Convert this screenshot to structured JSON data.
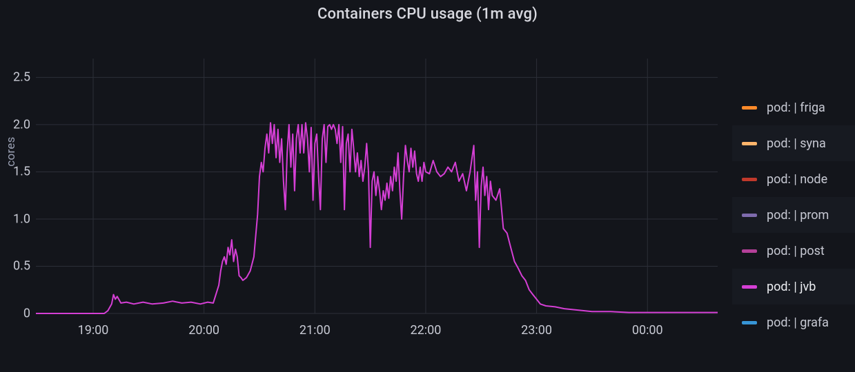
{
  "title": "Containers CPU usage (1m avg)",
  "ylabel": "cores",
  "chart_data": {
    "type": "line",
    "title": "Containers CPU usage (1m avg)",
    "xlabel": "",
    "ylabel": "cores",
    "ylim": [
      0,
      2.7
    ],
    "yticks": [
      0,
      0.5,
      1.0,
      1.5,
      2.0,
      2.5
    ],
    "xlim_minutes": [
      1109,
      1478
    ],
    "xticks_minutes": [
      1140,
      1200,
      1260,
      1320,
      1380,
      1440
    ],
    "xtick_labels": [
      "19:00",
      "20:00",
      "21:00",
      "22:00",
      "23:00",
      "00:00"
    ],
    "series": [
      {
        "name": "pod: | friga",
        "color": "#ff8a2a",
        "visible": false
      },
      {
        "name": "pod: | syna",
        "color": "#ffb56b",
        "visible": false
      },
      {
        "name": "pod: | node",
        "color": "#c0392b",
        "visible": false
      },
      {
        "name": "pod: | prom",
        "color": "#7e6bad",
        "visible": false
      },
      {
        "name": "pod: | post",
        "color": "#b54099",
        "visible": false
      },
      {
        "name": "pod: | jvb",
        "color": "#d53fd5",
        "visible": true
      },
      {
        "name": "pod: | grafa",
        "color": "#3795d6",
        "visible": false
      }
    ],
    "jvb_points": [
      [
        1109,
        0.0
      ],
      [
        1145,
        0.0
      ],
      [
        1146,
        0.0
      ],
      [
        1148,
        0.03
      ],
      [
        1150,
        0.1
      ],
      [
        1151,
        0.2
      ],
      [
        1152,
        0.15
      ],
      [
        1153,
        0.18
      ],
      [
        1155,
        0.11
      ],
      [
        1158,
        0.12
      ],
      [
        1162,
        0.1
      ],
      [
        1167,
        0.12
      ],
      [
        1172,
        0.1
      ],
      [
        1178,
        0.11
      ],
      [
        1183,
        0.13
      ],
      [
        1188,
        0.11
      ],
      [
        1193,
        0.12
      ],
      [
        1198,
        0.1
      ],
      [
        1202,
        0.12
      ],
      [
        1205,
        0.11
      ],
      [
        1208,
        0.3
      ],
      [
        1209,
        0.45
      ],
      [
        1210,
        0.55
      ],
      [
        1211,
        0.6
      ],
      [
        1212,
        0.52
      ],
      [
        1213,
        0.7
      ],
      [
        1214,
        0.62
      ],
      [
        1215,
        0.78
      ],
      [
        1216,
        0.55
      ],
      [
        1217,
        0.68
      ],
      [
        1218,
        0.6
      ],
      [
        1219,
        0.4
      ],
      [
        1220,
        0.38
      ],
      [
        1221,
        0.35
      ],
      [
        1223,
        0.38
      ],
      [
        1225,
        0.45
      ],
      [
        1227,
        0.6
      ],
      [
        1229,
        1.05
      ],
      [
        1230,
        1.45
      ],
      [
        1231,
        1.6
      ],
      [
        1232,
        1.5
      ],
      [
        1233,
        1.75
      ],
      [
        1234,
        1.9
      ],
      [
        1235,
        1.7
      ],
      [
        1236,
        2.02
      ],
      [
        1237,
        1.8
      ],
      [
        1238,
        2.0
      ],
      [
        1239,
        1.65
      ],
      [
        1240,
        1.95
      ],
      [
        1241,
        1.6
      ],
      [
        1242,
        1.85
      ],
      [
        1243,
        1.4
      ],
      [
        1244,
        1.1
      ],
      [
        1245,
        1.7
      ],
      [
        1246,
        2.0
      ],
      [
        1247,
        1.55
      ],
      [
        1248,
        1.9
      ],
      [
        1249,
        1.3
      ],
      [
        1250,
        1.85
      ],
      [
        1251,
        2.0
      ],
      [
        1252,
        1.7
      ],
      [
        1253,
        2.0
      ],
      [
        1254,
        1.7
      ],
      [
        1255,
        2.02
      ],
      [
        1256,
        1.85
      ],
      [
        1257,
        1.5
      ],
      [
        1258,
        1.97
      ],
      [
        1259,
        1.2
      ],
      [
        1260,
        1.8
      ],
      [
        1261,
        1.9
      ],
      [
        1262,
        1.45
      ],
      [
        1263,
        1.1
      ],
      [
        1264,
        1.85
      ],
      [
        1265,
        2.0
      ],
      [
        1266,
        1.6
      ],
      [
        1267,
        1.98
      ],
      [
        1268,
        2.0
      ],
      [
        1269,
        1.95
      ],
      [
        1270,
        2.0
      ],
      [
        1271,
        1.95
      ],
      [
        1272,
        1.8
      ],
      [
        1273,
        2.0
      ],
      [
        1274,
        1.6
      ],
      [
        1275,
        1.98
      ],
      [
        1276,
        1.1
      ],
      [
        1277,
        1.8
      ],
      [
        1278,
        1.9
      ],
      [
        1279,
        1.5
      ],
      [
        1280,
        1.95
      ],
      [
        1281,
        1.75
      ],
      [
        1282,
        1.5
      ],
      [
        1283,
        1.7
      ],
      [
        1284,
        1.45
      ],
      [
        1285,
        1.62
      ],
      [
        1286,
        1.4
      ],
      [
        1287,
        1.55
      ],
      [
        1288,
        1.8
      ],
      [
        1289,
        1.5
      ],
      [
        1290,
        0.7
      ],
      [
        1291,
        1.4
      ],
      [
        1292,
        1.5
      ],
      [
        1293,
        1.25
      ],
      [
        1294,
        1.45
      ],
      [
        1295,
        1.3
      ],
      [
        1296,
        1.1
      ],
      [
        1297,
        1.3
      ],
      [
        1298,
        1.2
      ],
      [
        1299,
        1.38
      ],
      [
        1300,
        1.22
      ],
      [
        1301,
        1.45
      ],
      [
        1302,
        1.3
      ],
      [
        1303,
        1.55
      ],
      [
        1304,
        1.4
      ],
      [
        1305,
        1.7
      ],
      [
        1306,
        1.3
      ],
      [
        1307,
        1.0
      ],
      [
        1308,
        1.45
      ],
      [
        1309,
        1.78
      ],
      [
        1310,
        1.62
      ],
      [
        1311,
        1.5
      ],
      [
        1312,
        1.75
      ],
      [
        1313,
        1.55
      ],
      [
        1314,
        1.72
      ],
      [
        1315,
        1.48
      ],
      [
        1316,
        1.4
      ],
      [
        1317,
        1.55
      ],
      [
        1318,
        1.4
      ],
      [
        1319,
        1.6
      ],
      [
        1320,
        1.5
      ],
      [
        1322,
        1.48
      ],
      [
        1324,
        1.62
      ],
      [
        1326,
        1.5
      ],
      [
        1328,
        1.45
      ],
      [
        1330,
        1.48
      ],
      [
        1332,
        1.55
      ],
      [
        1334,
        1.5
      ],
      [
        1336,
        1.6
      ],
      [
        1338,
        1.4
      ],
      [
        1340,
        1.48
      ],
      [
        1342,
        1.3
      ],
      [
        1344,
        1.5
      ],
      [
        1346,
        1.78
      ],
      [
        1347,
        1.2
      ],
      [
        1348,
        1.5
      ],
      [
        1349,
        0.7
      ],
      [
        1350,
        1.35
      ],
      [
        1351,
        1.55
      ],
      [
        1352,
        1.25
      ],
      [
        1353,
        1.45
      ],
      [
        1354,
        1.1
      ],
      [
        1355,
        1.4
      ],
      [
        1356,
        1.25
      ],
      [
        1358,
        1.2
      ],
      [
        1360,
        1.32
      ],
      [
        1362,
        0.9
      ],
      [
        1364,
        0.85
      ],
      [
        1366,
        0.7
      ],
      [
        1368,
        0.55
      ],
      [
        1370,
        0.48
      ],
      [
        1372,
        0.4
      ],
      [
        1374,
        0.35
      ],
      [
        1376,
        0.25
      ],
      [
        1378,
        0.2
      ],
      [
        1380,
        0.15
      ],
      [
        1382,
        0.1
      ],
      [
        1385,
        0.08
      ],
      [
        1390,
        0.07
      ],
      [
        1395,
        0.05
      ],
      [
        1400,
        0.04
      ],
      [
        1410,
        0.02
      ],
      [
        1420,
        0.02
      ],
      [
        1430,
        0.01
      ],
      [
        1440,
        0.01
      ],
      [
        1455,
        0.01
      ],
      [
        1470,
        0.01
      ],
      [
        1478,
        0.01
      ]
    ]
  },
  "legend": {
    "items": [
      {
        "label": "pod: | friga",
        "color": "#ff8a2a",
        "active": false
      },
      {
        "label": "pod: | syna",
        "color": "#ffb56b",
        "active": false
      },
      {
        "label": "pod: | node",
        "color": "#c0392b",
        "active": false
      },
      {
        "label": "pod: | prom",
        "color": "#7e6bad",
        "active": false
      },
      {
        "label": "pod: | post",
        "color": "#b54099",
        "active": false
      },
      {
        "label": "pod: | jvb",
        "color": "#d53fd5",
        "active": true
      },
      {
        "label": "pod: | grafa",
        "color": "#3795d6",
        "active": false
      }
    ]
  }
}
